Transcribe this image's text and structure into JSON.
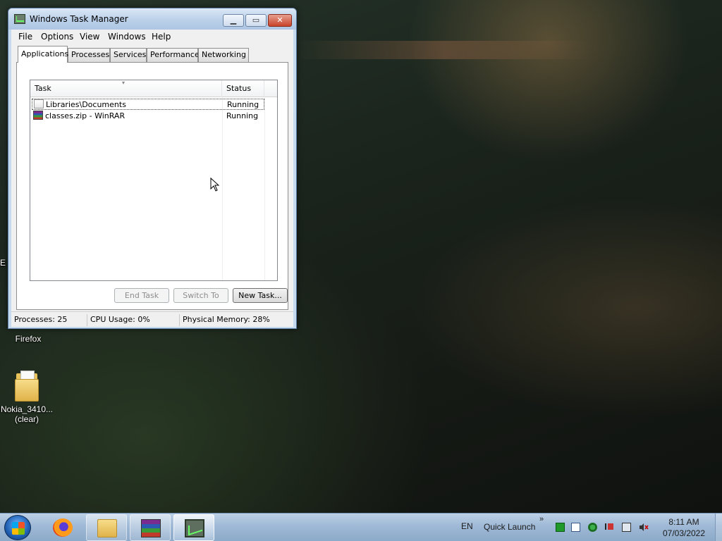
{
  "window": {
    "title": "Windows Task Manager",
    "menu": [
      "File",
      "Options",
      "View",
      "Windows",
      "Help"
    ],
    "tabs": [
      "Applications",
      "Processes",
      "Services",
      "Performance",
      "Networking"
    ],
    "active_tab": "Applications",
    "columns": [
      "Task",
      "Status"
    ],
    "rows": [
      {
        "task": "Libraries\\Documents",
        "status": "Running",
        "icon": "document-icon"
      },
      {
        "task": "classes.zip - WinRAR",
        "status": "Running",
        "icon": "winrar-icon"
      }
    ],
    "buttons": {
      "end_task": "End Task",
      "switch_to": "Switch To",
      "new_task": "New Task..."
    },
    "status": {
      "processes": "Processes: 25",
      "cpu": "CPU Usage: 0%",
      "memory": "Physical Memory: 28%"
    }
  },
  "desktop": {
    "icons": [
      {
        "label": "Firefox"
      },
      {
        "label": "Nokia_3410...",
        "label2": "(clear)"
      }
    ],
    "edge_letter": "E"
  },
  "taskbar": {
    "language": "EN",
    "quick_launch": "Quick Launch",
    "chevron": "»",
    "time": "8:11 AM",
    "date": "07/03/2022"
  }
}
